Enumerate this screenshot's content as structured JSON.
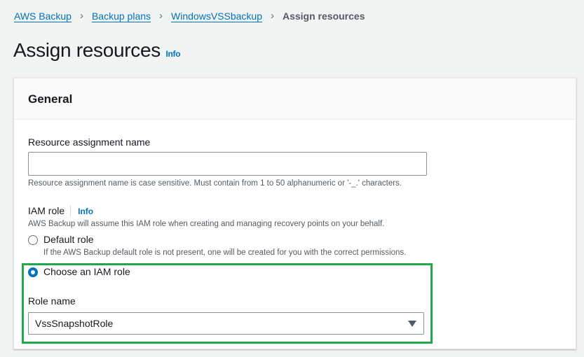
{
  "breadcrumb": [
    "AWS Backup",
    "Backup plans",
    "WindowsVSSbackup"
  ],
  "breadcrumb_current": "Assign resources",
  "page_title": "Assign resources",
  "info_label": "Info",
  "section_title": "General",
  "assignment": {
    "label": "Resource assignment name",
    "value": "",
    "hint": "Resource assignment name is case sensitive. Must contain from 1 to 50 alphanumeric or '-_.' characters."
  },
  "iam": {
    "label": "IAM role",
    "info": "Info",
    "description": "AWS Backup will assume this IAM role when creating and managing recovery points on your behalf.",
    "options": [
      {
        "label": "Default role",
        "hint": "If the AWS Backup default role is not present, one will be created for you with the correct permissions.",
        "selected": false
      },
      {
        "label": "Choose an IAM role",
        "selected": true
      }
    ],
    "role_name_label": "Role name",
    "role_name_value": "VssSnapshotRole"
  },
  "colors": {
    "link": "#0073bb",
    "highlight": "#1fa94b"
  }
}
